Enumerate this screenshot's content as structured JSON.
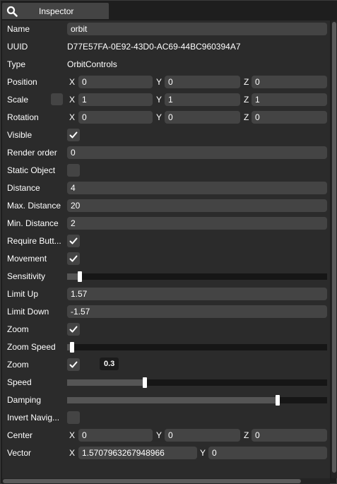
{
  "header": {
    "tab_label": "Inspector",
    "search_icon": "search-icon"
  },
  "fields": {
    "name": {
      "label": "Name",
      "value": "orbit"
    },
    "uuid": {
      "label": "UUID",
      "value": "D77E57FA-0E92-43D0-AC69-44BC960394A7"
    },
    "type": {
      "label": "Type",
      "value": "OrbitControls"
    },
    "position": {
      "label": "Position",
      "x_label": "X",
      "x": "0",
      "y_label": "Y",
      "y": "0",
      "z_label": "Z",
      "z": "0"
    },
    "scale": {
      "label": "Scale",
      "x_label": "X",
      "x": "1",
      "y_label": "Y",
      "y": "1",
      "z_label": "Z",
      "z": "1"
    },
    "rotation": {
      "label": "Rotation",
      "x_label": "X",
      "x": "0",
      "y_label": "Y",
      "y": "0",
      "z_label": "Z",
      "z": "0"
    },
    "visible": {
      "label": "Visible",
      "checked": true
    },
    "render_order": {
      "label": "Render order",
      "value": "0"
    },
    "static_object": {
      "label": "Static Object",
      "checked": false
    },
    "distance": {
      "label": "Distance",
      "value": "4"
    },
    "max_distance": {
      "label": "Max. Distance",
      "value": "20"
    },
    "min_distance": {
      "label": "Min. Distance",
      "value": "2"
    },
    "require_button": {
      "label": "Require Butt...",
      "checked": true
    },
    "movement": {
      "label": "Movement",
      "checked": true
    },
    "sensitivity": {
      "label": "Sensitivity",
      "level": 0.05
    },
    "limit_up": {
      "label": "Limit Up",
      "value": "1.57"
    },
    "limit_down": {
      "label": "Limit Down",
      "value": "-1.57"
    },
    "zoom": {
      "label": "Zoom",
      "checked": true
    },
    "zoom_speed": {
      "label": "Zoom Speed",
      "level": 0.02
    },
    "zoom2": {
      "label": "Zoom",
      "checked": true,
      "tooltip": "0.3"
    },
    "speed": {
      "label": "Speed",
      "level": 0.3
    },
    "damping": {
      "label": "Damping",
      "level": 0.81
    },
    "invert_navigation": {
      "label": "Invert Navig...",
      "checked": false
    },
    "center": {
      "label": "Center",
      "x_label": "X",
      "x": "0",
      "y_label": "Y",
      "y": "0",
      "z_label": "Z",
      "z": "0"
    },
    "vector": {
      "label": "Vector",
      "x_label": "X",
      "x": "1.5707963267948966",
      "y_label": "Y",
      "y": "0"
    }
  },
  "colors": {
    "background": "#1e1e1e",
    "panel": "#2b2b2b",
    "input": "#444444",
    "slider_track": "#161616",
    "slider_fill": "#555555",
    "text": "#ffffff"
  }
}
